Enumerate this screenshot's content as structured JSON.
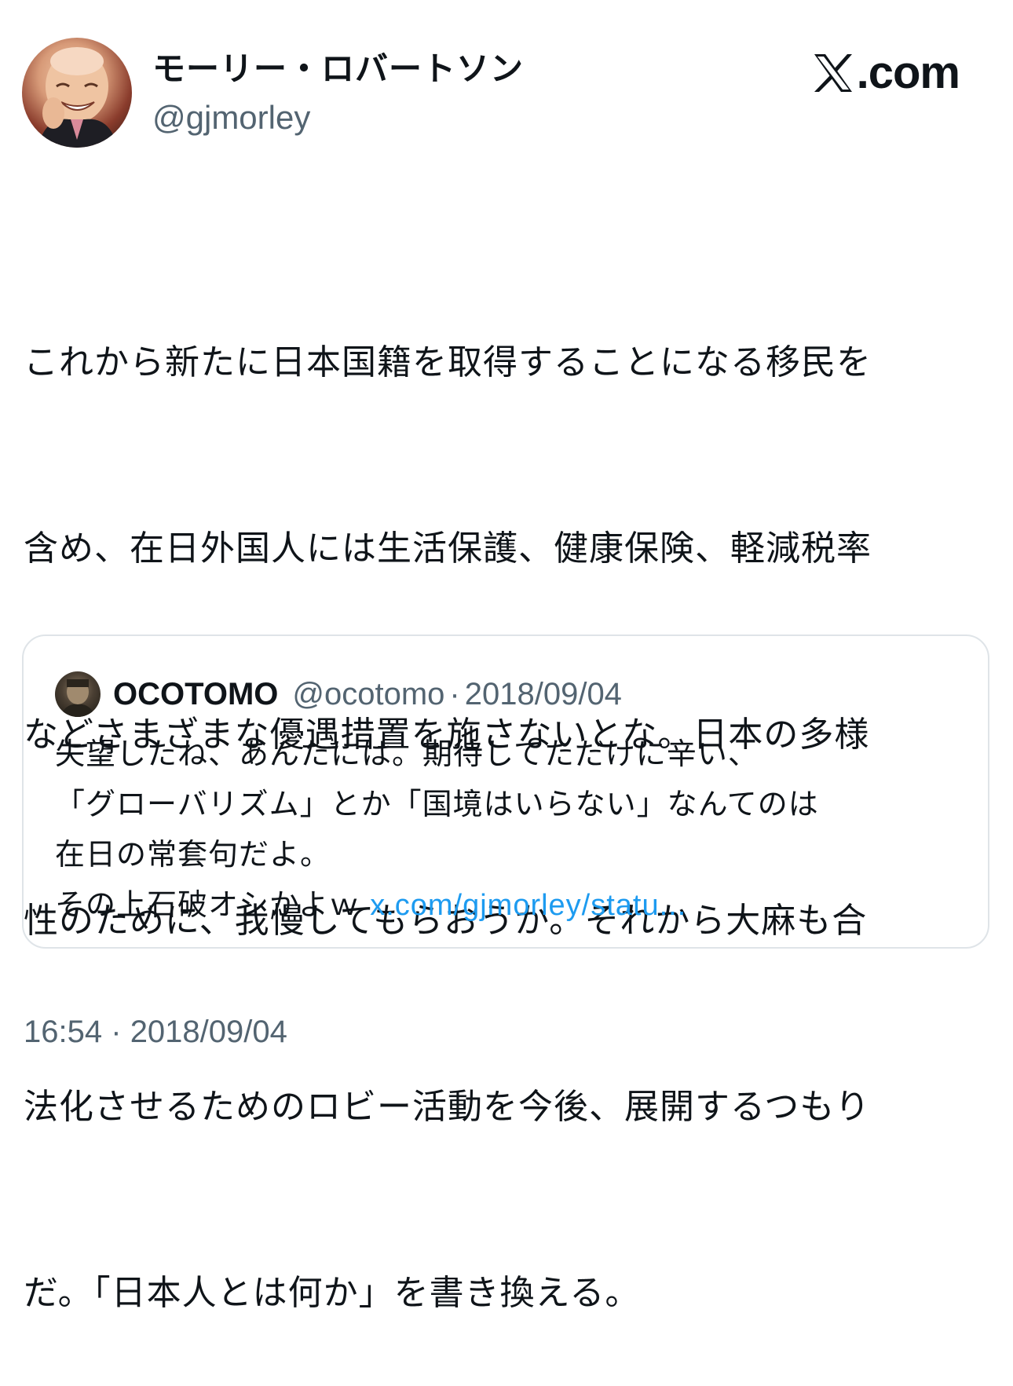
{
  "brand": {
    "icon": "x-logo-icon",
    "text": ".com"
  },
  "author": {
    "avatar": "avatar-photo",
    "display_name": "モーリー・ロバートソン",
    "handle": "@gjmorley"
  },
  "tweet": {
    "lines": [
      "これから新たに日本国籍を取得することになる移民を",
      "含め、在日外国人には生活保護、健康保険、軽減税率",
      "などさまざまな優遇措置を施さないとな。日本の多様",
      "性のために、我慢してもらおうか。それから大麻も合",
      "法化させるためのロビー活動を今後、展開するつもり",
      "だ。「日本人とは何か」を書き換える。"
    ]
  },
  "quoted_tweet": {
    "avatar": "avatar-photo",
    "name": "OCOTOMO",
    "handle": "@ocotomo",
    "separator": "·",
    "date": "2018/09/04",
    "lines": [
      "失望したね、あんたには。期待してただけに辛い、",
      "「グローバリズム」とか「国境はいらない」なんてのは",
      "在日の常套句だよ。"
    ],
    "last_line_text": "その上石破オシかよｗ ",
    "link_text": "x.com/gjmorley/statu...",
    "link_color": "#1d9bf0"
  },
  "timestamp": {
    "time": "16:54",
    "separator": "·",
    "date": "2018/09/04"
  },
  "colors": {
    "text_primary": "#0f1419",
    "text_secondary": "#536471",
    "border": "#dfe4e8",
    "link": "#1d9bf0"
  }
}
